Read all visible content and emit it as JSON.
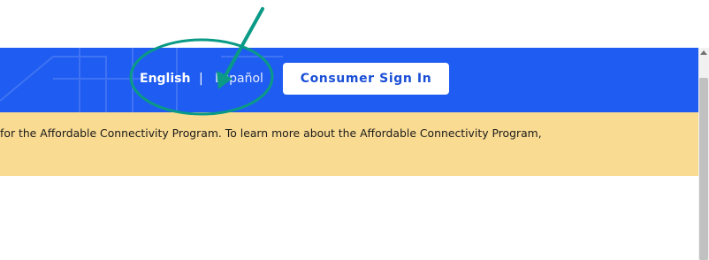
{
  "header": {
    "language_english": "English",
    "language_separator": "|",
    "language_spanish": "Español",
    "signin_label": "Consumer Sign In"
  },
  "notice": {
    "text": "for the Affordable Connectivity Program. To learn more about the Affordable Connectivity Program,"
  },
  "colors": {
    "header_blue": "#1f5cf1",
    "notice_yellow": "#fadb92",
    "annotation_teal": "#0a9a85"
  },
  "icons": {
    "annotation_arrow": "arrow-icon",
    "annotation_circle": "highlight-ellipse-icon",
    "scroll_up": "chevron-up-icon"
  }
}
